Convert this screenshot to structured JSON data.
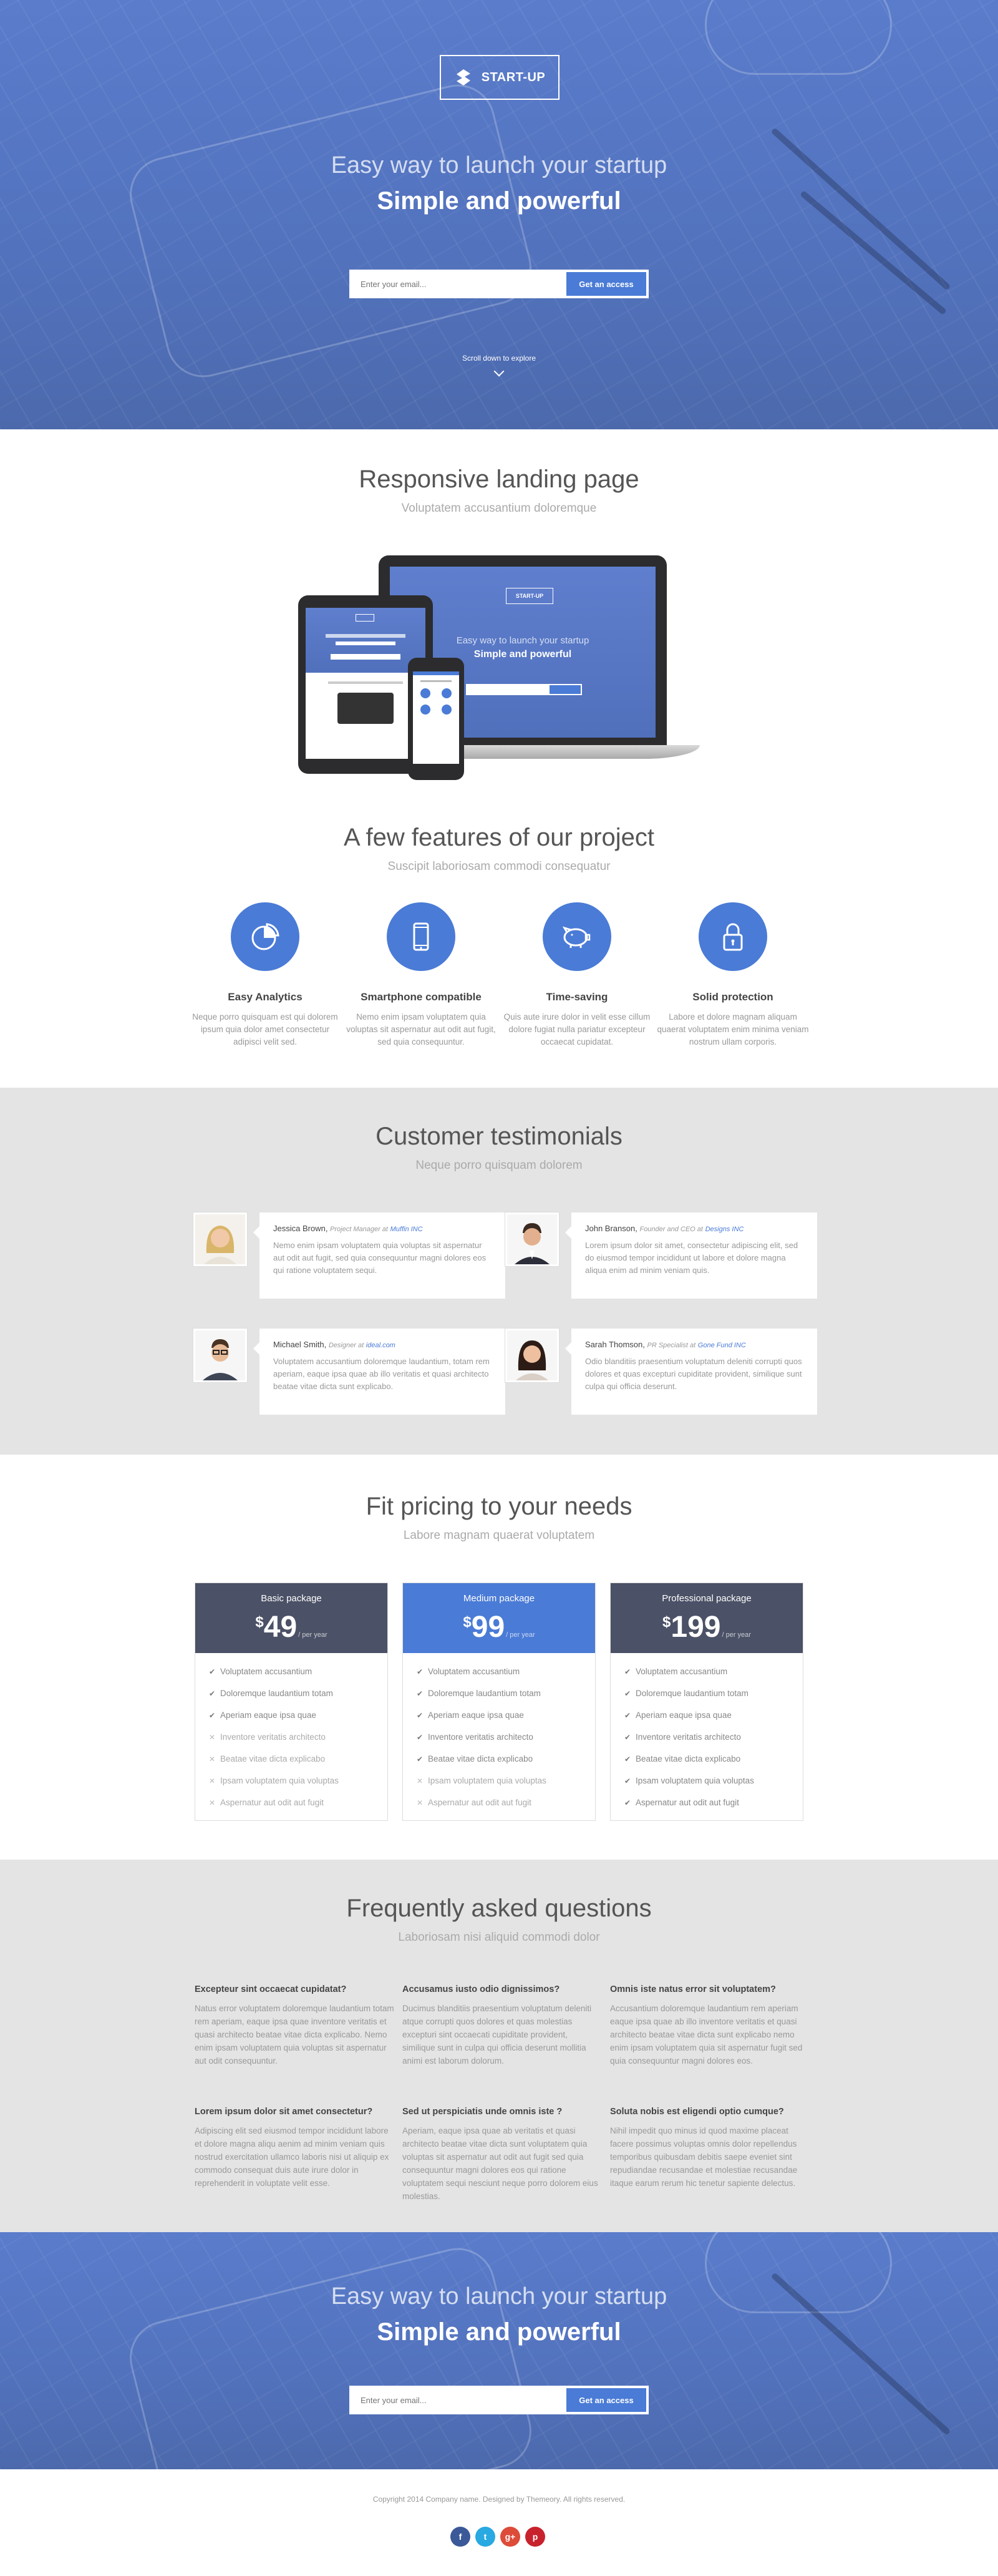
{
  "colors": {
    "accent": "#4a7bd6",
    "dark_header": "#4b5166",
    "band": "#e4e4e4"
  },
  "brand": {
    "logo_text": "START-UP",
    "logo_icon": "bolt-s-icon"
  },
  "hero": {
    "title": "Easy way to launch your startup",
    "subtitle": "Simple and powerful",
    "email_placeholder": "Enter your email...",
    "cta_label": "Get an access",
    "scroll_label": "Scroll down to explore"
  },
  "responsive": {
    "title": "Responsive landing page",
    "subtitle": "Voluptatem accusantium doloremque",
    "mock_brand": "START-UP",
    "mock_title": "Easy way to launch your startup",
    "mock_subtitle": "Simple and powerful"
  },
  "features": {
    "title": "A few features of our project",
    "subtitle": "Suscipit laboriosam commodi consequatur",
    "items": [
      {
        "icon": "pie-chart-icon",
        "title": "Easy Analytics",
        "text": "Neque porro quisquam est qui dolorem ipsum quia dolor amet consectetur adipisci velit sed."
      },
      {
        "icon": "smartphone-icon",
        "title": "Smartphone compatible",
        "text": "Nemo enim ipsam voluptatem quia voluptas sit aspernatur aut odit aut fugit, sed quia consequuntur."
      },
      {
        "icon": "piggy-bank-icon",
        "title": "Time-saving",
        "text": "Quis aute irure dolor in velit esse cillum dolore fugiat nulla pariatur excepteur occaecat cupidatat."
      },
      {
        "icon": "padlock-icon",
        "title": "Solid protection",
        "text": "Labore et dolore magnam aliquam quaerat voluptatem enim minima veniam nostrum ullam corporis."
      }
    ]
  },
  "testimonials": {
    "title": "Customer testimonials",
    "subtitle": "Neque porro quisquam dolorem",
    "items": [
      {
        "name": "Jessica Brown",
        "role": "Project Manager at",
        "org": "Muffin INC",
        "text": "Nemo enim ipsam voluptatem quia voluptas sit aspernatur aut odit aut fugit, sed quia consequuntur magni dolores eos qui ratione voluptatem sequi."
      },
      {
        "name": "John Branson",
        "role": "Founder and CEO at",
        "org": "Designs INC",
        "text": "Lorem ipsum dolor sit amet, consectetur adipiscing elit, sed do eiusmod tempor incididunt ut labore et dolore magna aliqua enim ad minim veniam quis."
      },
      {
        "name": "Michael Smith",
        "role": "Designer at",
        "org": "ideal.com",
        "text": "Voluptatem accusantium doloremque laudantium, totam rem aperiam, eaque ipsa quae ab illo veritatis et quasi architecto beatae vitae dicta sunt explicabo."
      },
      {
        "name": "Sarah Thomson",
        "role": "PR Specialist at",
        "org": "Gone Fund INC",
        "text": "Odio blanditiis praesentium voluptatum deleniti corrupti quos dolores et quas excepturi cupiditate provident, similique sunt culpa qui officia deserunt."
      }
    ]
  },
  "pricing": {
    "title": "Fit pricing to your needs",
    "subtitle": "Labore magnam quaerat voluptatem",
    "currency": "$",
    "period": "/ per year",
    "plans": [
      {
        "name": "Basic package",
        "price": "49",
        "features": [
          {
            "label": "Voluptatem accusantium",
            "on": true
          },
          {
            "label": "Doloremque laudantium totam",
            "on": true
          },
          {
            "label": "Aperiam eaque ipsa quae",
            "on": true
          },
          {
            "label": "Inventore veritatis architecto",
            "on": false
          },
          {
            "label": "Beatae vitae dicta explicabo",
            "on": false
          },
          {
            "label": "Ipsam voluptatem quia voluptas",
            "on": false
          },
          {
            "label": "Aspernatur aut odit aut fugit",
            "on": false
          }
        ]
      },
      {
        "name": "Medium package",
        "price": "99",
        "features": [
          {
            "label": "Voluptatem accusantium",
            "on": true
          },
          {
            "label": "Doloremque laudantium totam",
            "on": true
          },
          {
            "label": "Aperiam eaque ipsa quae",
            "on": true
          },
          {
            "label": "Inventore veritatis architecto",
            "on": true
          },
          {
            "label": "Beatae vitae dicta explicabo",
            "on": true
          },
          {
            "label": "Ipsam voluptatem quia voluptas",
            "on": false
          },
          {
            "label": "Aspernatur aut odit aut fugit",
            "on": false
          }
        ]
      },
      {
        "name": "Professional package",
        "price": "199",
        "features": [
          {
            "label": "Voluptatem accusantium",
            "on": true
          },
          {
            "label": "Doloremque laudantium totam",
            "on": true
          },
          {
            "label": "Aperiam eaque ipsa quae",
            "on": true
          },
          {
            "label": "Inventore veritatis architecto",
            "on": true
          },
          {
            "label": "Beatae vitae dicta explicabo",
            "on": true
          },
          {
            "label": "Ipsam voluptatem quia voluptas",
            "on": true
          },
          {
            "label": "Aspernatur aut odit aut fugit",
            "on": true
          }
        ]
      }
    ]
  },
  "faq": {
    "title": "Frequently asked questions",
    "subtitle": "Laboriosam nisi aliquid commodi dolor",
    "items": [
      {
        "q": "Excepteur sint occaecat cupidatat?",
        "a": "Natus error voluptatem doloremque laudantium totam rem aperiam, eaque ipsa quae inventore veritatis et quasi architecto beatae vitae dicta explicabo. Nemo enim ipsam voluptatem quia voluptas sit aspernatur aut odit consequuntur."
      },
      {
        "q": "Accusamus iusto odio dignissimos?",
        "a": "Ducimus blanditiis praesentium voluptatum deleniti atque corrupti quos dolores et quas molestias excepturi sint occaecati cupiditate provident, similique sunt in culpa qui officia deserunt mollitia animi est laborum dolorum."
      },
      {
        "q": "Omnis iste natus error sit voluptatem?",
        "a": "Accusantium doloremque laudantium rem aperiam eaque ipsa quae ab illo inventore veritatis et quasi architecto beatae vitae dicta sunt explicabo nemo enim ipsam voluptatem quia sit aspernatur fugit sed quia consequuntur magni dolores eos."
      },
      {
        "q": "Lorem ipsum dolor sit amet consectetur?",
        "a": "Adipiscing elit sed eiusmod tempor incididunt labore et dolore magna aliqu aenim ad minim veniam quis nostrud exercitation ullamco laboris nisi ut aliquip ex commodo consequat duis aute irure dolor in reprehenderit in voluptate velit esse."
      },
      {
        "q": "Sed ut perspiciatis unde omnis iste ?",
        "a": "Aperiam, eaque ipsa quae ab veritatis et quasi architecto beatae vitae dicta sunt voluptatem quia voluptas sit aspernatur aut odit aut fugit sed quia consequuntur magni dolores eos qui ratione voluptatem sequi nesciunt neque porro dolorem eius molestias."
      },
      {
        "q": "Soluta nobis est eligendi optio cumque?",
        "a": "Nihil impedit quo minus id quod maxime placeat facere possimus voluptas omnis dolor repellendus temporibus quibusdam debitis saepe eveniet sint repudiandae recusandae et molestiae recusandae itaque earum rerum hic tenetur sapiente delectus."
      }
    ]
  },
  "footer": {
    "copyright": "Copyright 2014 Company name. Designed by Themeory. All rights reserved.",
    "socials": [
      {
        "icon": "facebook-icon",
        "glyph": "f",
        "color": "#3b5998"
      },
      {
        "icon": "twitter-icon",
        "glyph": "t",
        "color": "#29a9e1"
      },
      {
        "icon": "google-plus-icon",
        "glyph": "g+",
        "color": "#dd4b39"
      },
      {
        "icon": "pinterest-icon",
        "glyph": "p",
        "color": "#c8232c"
      }
    ]
  }
}
